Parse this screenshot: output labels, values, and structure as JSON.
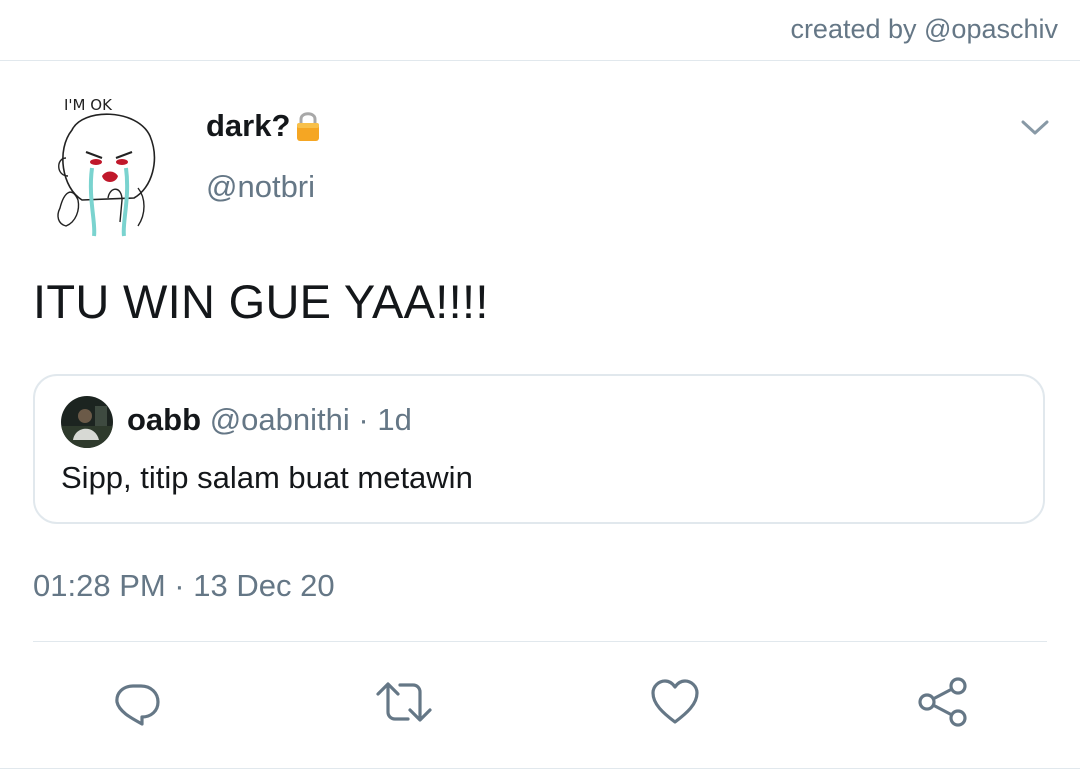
{
  "header": {
    "credit": "created by @opaschiv"
  },
  "tweet": {
    "display_name": "dark?",
    "handle": "@notbri",
    "avatar_caption": "I'M OK",
    "text": "ITU WIN GUE YAA!!!!",
    "timestamp": "01:28 PM · 13 Dec 20"
  },
  "quote": {
    "name": "oabb",
    "handle": "@oabnithi",
    "separator": "·",
    "time": "1d",
    "text": "Sipp, titip salam buat metawin"
  },
  "icons": {
    "lock": "lock-icon",
    "menu": "chevron-down-icon",
    "reply": "reply-icon",
    "retweet": "retweet-icon",
    "like": "heart-icon",
    "share": "share-icon"
  },
  "colors": {
    "text_primary": "#14171a",
    "text_secondary": "#657786",
    "border": "#e1e8ed",
    "lock_gold": "#f5a623"
  }
}
